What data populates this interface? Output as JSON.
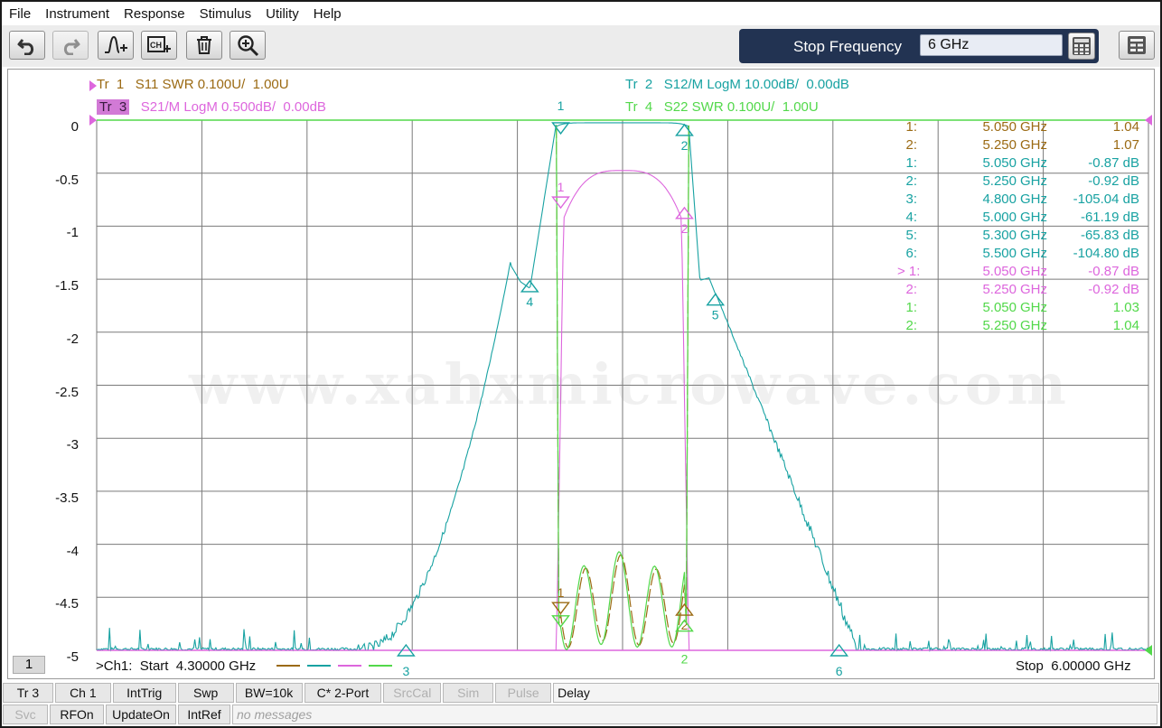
{
  "menu": [
    "File",
    "Instrument",
    "Response",
    "Stimulus",
    "Utility",
    "Help"
  ],
  "toolbar": {
    "buttons": [
      "undo-icon",
      "redo-icon",
      "add-trace-icon",
      "add-channel-icon",
      "delete-icon",
      "zoom-icon"
    ],
    "stop_frequency_label": "Stop Frequency",
    "stop_frequency_value": "6 GHz"
  },
  "traces": [
    {
      "id": "Tr  1",
      "desc": "S11 SWR 0.100U/  1.00U",
      "color": "#9b6a13"
    },
    {
      "id": "Tr  2",
      "desc": "S12/M LogM 10.00dB/  0.00dB",
      "color": "#18a2a2"
    },
    {
      "id": "Tr  3",
      "desc": "S21/M LogM 0.500dB/  0.00dB",
      "color": "#dd66dd",
      "active": true
    },
    {
      "id": "Tr  4",
      "desc": "S22 SWR 0.100U/  1.00U",
      "color": "#52d84a"
    }
  ],
  "y_ticks": [
    "0",
    "-0.5",
    "-1",
    "-1.5",
    "-2",
    "-2.5",
    "-3",
    "-3.5",
    "-4",
    "-4.5",
    "-5"
  ],
  "markers_table": [
    {
      "idx": "1:",
      "freq": "5.050",
      "unit": "GHz",
      "value": "1.04",
      "color": "#9b6a13"
    },
    {
      "idx": "2:",
      "freq": "5.250",
      "unit": "GHz",
      "value": "1.07",
      "color": "#9b6a13"
    },
    {
      "idx": "1:",
      "freq": "5.050",
      "unit": "GHz",
      "value": "-0.87 dB",
      "color": "#18a2a2"
    },
    {
      "idx": "2:",
      "freq": "5.250",
      "unit": "GHz",
      "value": "-0.92 dB",
      "color": "#18a2a2"
    },
    {
      "idx": "3:",
      "freq": "4.800",
      "unit": "GHz",
      "value": "-105.04 dB",
      "color": "#18a2a2"
    },
    {
      "idx": "4:",
      "freq": "5.000",
      "unit": "GHz",
      "value": "-61.19 dB",
      "color": "#18a2a2"
    },
    {
      "idx": "5:",
      "freq": "5.300",
      "unit": "GHz",
      "value": "-65.83 dB",
      "color": "#18a2a2"
    },
    {
      "idx": "6:",
      "freq": "5.500",
      "unit": "GHz",
      "value": "-104.80 dB",
      "color": "#18a2a2"
    },
    {
      "idx": "> 1:",
      "freq": "5.050",
      "unit": "GHz",
      "value": "-0.87 dB",
      "color": "#dd66dd"
    },
    {
      "idx": "2:",
      "freq": "5.250",
      "unit": "GHz",
      "value": "-0.92 dB",
      "color": "#dd66dd"
    },
    {
      "idx": "1:",
      "freq": "5.050",
      "unit": "GHz",
      "value": "1.03",
      "color": "#52d84a"
    },
    {
      "idx": "2:",
      "freq": "5.250",
      "unit": "GHz",
      "value": "1.04",
      "color": "#52d84a"
    }
  ],
  "watermark": "www.xahxmicrowave.com",
  "channel_badge": "1",
  "start_label": ">Ch1:  Start  4.30000 GHz",
  "stop_label": "Stop  6.00000 GHz",
  "status_row1": [
    {
      "label": "Tr 3",
      "enabled": true
    },
    {
      "label": "Ch 1",
      "enabled": true
    },
    {
      "label": "IntTrig",
      "enabled": true
    },
    {
      "label": "Swp",
      "enabled": true
    },
    {
      "label": "BW=10k",
      "enabled": true
    },
    {
      "label": "C* 2-Port",
      "enabled": true
    },
    {
      "label": "SrcCal",
      "enabled": false
    },
    {
      "label": "Sim",
      "enabled": false
    },
    {
      "label": "Pulse",
      "enabled": false
    },
    {
      "label": "Delay",
      "enabled": true
    }
  ],
  "status_row2": [
    {
      "label": "Svc",
      "enabled": false
    },
    {
      "label": "RFOn",
      "enabled": true
    },
    {
      "label": "UpdateOn",
      "enabled": true
    },
    {
      "label": "IntRef",
      "enabled": true
    },
    {
      "label": "no messages",
      "enabled": false
    }
  ],
  "chart_data": {
    "type": "line",
    "x_range": [
      4.3,
      6.0
    ],
    "ylim": [
      -5,
      0
    ],
    "grid": true,
    "series": [
      {
        "name": "S11 SWR",
        "color": "#9b6a13",
        "markers": [
          {
            "label": "1",
            "x": 5.05,
            "y": 1.04
          },
          {
            "label": "2",
            "x": 5.25,
            "y": 1.07
          }
        ]
      },
      {
        "name": "S12/M LogM",
        "color": "#18a2a2",
        "markers": [
          {
            "label": "1",
            "x": 5.05,
            "y": -0.87
          },
          {
            "label": "2",
            "x": 5.25,
            "y": -0.92
          },
          {
            "label": "3",
            "x": 4.8,
            "y": -105.04
          },
          {
            "label": "4",
            "x": 5.0,
            "y": -61.19
          },
          {
            "label": "5",
            "x": 5.3,
            "y": -65.83
          },
          {
            "label": "6",
            "x": 5.5,
            "y": -104.8
          }
        ]
      },
      {
        "name": "S21/M LogM",
        "color": "#dd66dd",
        "markers": [
          {
            "label": "1",
            "x": 5.05,
            "y": -0.87
          },
          {
            "label": "2",
            "x": 5.25,
            "y": -0.92
          }
        ]
      },
      {
        "name": "S22 SWR",
        "color": "#52d84a",
        "markers": [
          {
            "label": "1",
            "x": 5.05,
            "y": 1.03
          },
          {
            "label": "2",
            "x": 5.25,
            "y": 1.04
          }
        ]
      }
    ]
  }
}
